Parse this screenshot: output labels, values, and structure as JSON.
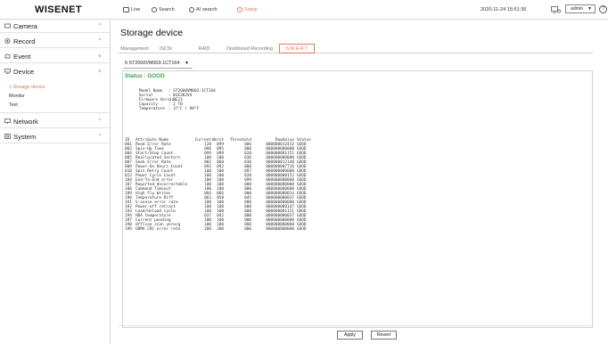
{
  "brand": "WISENET",
  "topnav": {
    "live": "Live",
    "search": "Search",
    "ai_search": "AI search",
    "setup": "Setup",
    "active_color": "#e8765c"
  },
  "datetime": "2020-11-24 15:51:36",
  "user": "admin",
  "help": "?",
  "sidebar": {
    "items": [
      {
        "label": "Camera",
        "icon": "camera-icon",
        "chevron": "^"
      },
      {
        "label": "Record",
        "icon": "record-icon",
        "chevron": "^"
      },
      {
        "label": "Event",
        "icon": "event-icon",
        "chevron": "v"
      },
      {
        "label": "Device",
        "icon": "device-icon",
        "chevron": "v"
      },
      {
        "label": "Network",
        "icon": "network-icon",
        "chevron": "^"
      },
      {
        "label": "System",
        "icon": "system-icon",
        "chevron": "^"
      }
    ],
    "device_sub": [
      {
        "label": "> Storage device",
        "active": true
      },
      {
        "label": "Monitor",
        "active": false
      },
      {
        "label": "Text",
        "active": false
      }
    ]
  },
  "page_title": "Storage device",
  "tabs": [
    {
      "label": "Management",
      "active": false
    },
    {
      "label": "iSCSI",
      "active": false
    },
    {
      "label": "RAID",
      "active": false
    },
    {
      "label": "Distributed Recording",
      "active": false
    },
    {
      "label": "S.M.A.R.T",
      "active": true
    }
  ],
  "disk_select": "6:ST2000VM003-1CT164",
  "status": "Status : GOOD",
  "info": [
    {
      "key": "Model Name",
      "value": ": ST2000VM003-1CT164"
    },
    {
      "key": "Serial",
      "value": ": W1E3K2V4"
    },
    {
      "key": "Firmware Version",
      "value": ": SC23"
    },
    {
      "key": "Capacity",
      "value": ": 2 TB"
    },
    {
      "key": "Temperature",
      "value": ": 37°C / 98°F"
    }
  ],
  "table": {
    "headers": [
      "ID",
      "Attribute Name",
      "Current",
      "Worst",
      "Threshold",
      "RawValue",
      "Status"
    ],
    "rows": [
      [
        "001",
        "Read Error Rate",
        "120",
        "099",
        "006",
        "000000012432",
        "GOOD"
      ],
      [
        "003",
        "Spin-Up Time",
        "096",
        "095",
        "000",
        "000000000000",
        "GOOD"
      ],
      [
        "004",
        "Start/Stop Count",
        "099",
        "099",
        "020",
        "000000001151",
        "GOOD"
      ],
      [
        "005",
        "Reallocated Sectors",
        "100",
        "100",
        "036",
        "000000000000",
        "GOOD"
      ],
      [
        "007",
        "Seek Error Rate",
        "082",
        "060",
        "030",
        "000000012148",
        "GOOD"
      ],
      [
        "009",
        "Power-On Hours Count",
        "092",
        "092",
        "000",
        "000000007716",
        "GOOD"
      ],
      [
        "010",
        "Spin Retry Count",
        "100",
        "100",
        "097",
        "000000000000",
        "GOOD"
      ],
      [
        "012",
        "Power Cycle Count",
        "100",
        "100",
        "020",
        "000000000152",
        "GOOD"
      ],
      [
        "184",
        "End-To-End error",
        "100",
        "100",
        "099",
        "000000000000",
        "GOOD"
      ],
      [
        "187",
        "Reported Uncorrectable",
        "100",
        "100",
        "000",
        "000000000000",
        "GOOD"
      ],
      [
        "188",
        "Command Timeout",
        "100",
        "100",
        "000",
        "000000000000",
        "GOOD"
      ],
      [
        "189",
        "High Fly Writes",
        "066",
        "066",
        "000",
        "000000000034",
        "GOOD"
      ],
      [
        "190",
        "Temperature Diff",
        "063",
        "058",
        "045",
        "000000000037",
        "GOOD"
      ],
      [
        "191",
        "G-sense error rate",
        "100",
        "100",
        "000",
        "000000000000",
        "GOOD"
      ],
      [
        "192",
        "Power-off retract",
        "100",
        "100",
        "000",
        "000000000147",
        "GOOD"
      ],
      [
        "193",
        "Load/Unload cycle",
        "100",
        "100",
        "000",
        "000000001151",
        "GOOD"
      ],
      [
        "194",
        "HDA temperature",
        "037",
        "042",
        "000",
        "000000000037",
        "GOOD"
      ],
      [
        "197",
        "Current pending",
        "100",
        "100",
        "000",
        "000000000000",
        "GOOD"
      ],
      [
        "198",
        "Offline scan unrecg",
        "100",
        "100",
        "000",
        "000000000000",
        "GOOD"
      ],
      [
        "199",
        "UDMA CRC error rate",
        "200",
        "200",
        "000",
        "000000000000",
        "GOOD"
      ]
    ]
  },
  "buttons": {
    "apply": "Apply",
    "revert": "Revert"
  }
}
